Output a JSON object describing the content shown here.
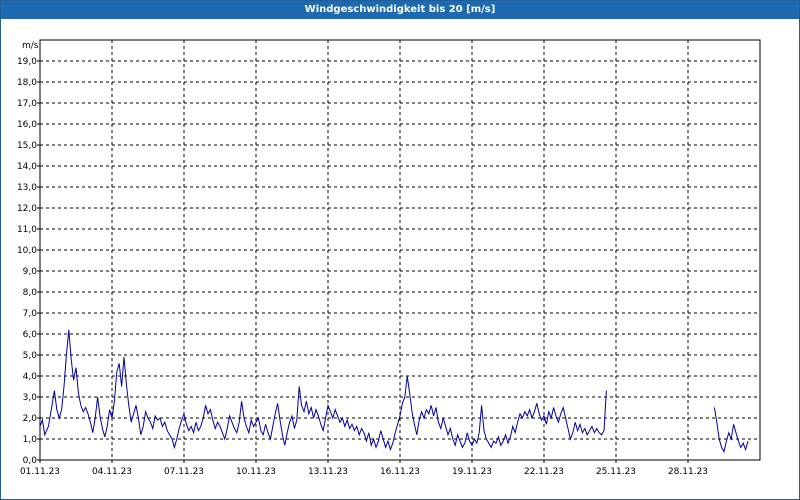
{
  "chart_data": {
    "type": "line",
    "title": "Windgeschwindigkeit bis 20 [m/s]",
    "ylabel": "m/s",
    "xlabel": "",
    "ylim": [
      0,
      20
    ],
    "xlim_days": [
      0,
      30
    ],
    "grid": true,
    "yticks": [
      "0,0",
      "1,0",
      "2,0",
      "3,0",
      "4,0",
      "5,0",
      "6,0",
      "7,0",
      "8,0",
      "9,0",
      "10,0",
      "11,0",
      "12,0",
      "13,0",
      "14,0",
      "15,0",
      "16,0",
      "17,0",
      "18,0",
      "19,0"
    ],
    "xticks": [
      "01.11.23",
      "04.11.23",
      "07.11.23",
      "10.11.23",
      "13.11.23",
      "16.11.23",
      "19.11.23",
      "22.11.23",
      "25.11.23",
      "28.11.23"
    ],
    "line_color": "#0000a0",
    "series": [
      {
        "segments": [
          [
            [
              0.0,
              1.6
            ],
            [
              0.1,
              1.9
            ],
            [
              0.2,
              1.2
            ],
            [
              0.35,
              1.6
            ],
            [
              0.5,
              2.6
            ],
            [
              0.6,
              3.3
            ],
            [
              0.7,
              2.4
            ],
            [
              0.8,
              2.0
            ],
            [
              0.9,
              2.4
            ],
            [
              1.0,
              3.5
            ],
            [
              1.1,
              5.0
            ],
            [
              1.2,
              6.2
            ],
            [
              1.3,
              4.8
            ],
            [
              1.4,
              3.8
            ],
            [
              1.5,
              4.4
            ],
            [
              1.6,
              3.2
            ],
            [
              1.7,
              2.6
            ],
            [
              1.8,
              2.3
            ],
            [
              1.9,
              2.5
            ],
            [
              2.0,
              2.2
            ],
            [
              2.1,
              1.8
            ],
            [
              2.2,
              1.3
            ],
            [
              2.3,
              2.0
            ],
            [
              2.4,
              3.0
            ],
            [
              2.5,
              2.1
            ],
            [
              2.6,
              1.5
            ],
            [
              2.7,
              1.1
            ],
            [
              2.8,
              1.6
            ],
            [
              2.9,
              2.4
            ],
            [
              3.0,
              2.0
            ],
            [
              3.1,
              2.8
            ],
            [
              3.2,
              4.2
            ],
            [
              3.3,
              4.6
            ],
            [
              3.4,
              3.5
            ],
            [
              3.5,
              4.9
            ],
            [
              3.6,
              3.6
            ],
            [
              3.7,
              2.6
            ],
            [
              3.8,
              1.8
            ],
            [
              3.9,
              2.2
            ],
            [
              4.0,
              2.6
            ],
            [
              4.1,
              2.0
            ],
            [
              4.2,
              1.2
            ],
            [
              4.3,
              1.6
            ],
            [
              4.4,
              2.3
            ],
            [
              4.5,
              2.0
            ],
            [
              4.6,
              1.8
            ],
            [
              4.7,
              1.5
            ],
            [
              4.8,
              2.1
            ],
            [
              4.9,
              1.9
            ],
            [
              5.0,
              2.0
            ],
            [
              5.1,
              1.6
            ],
            [
              5.2,
              1.8
            ],
            [
              5.3,
              1.4
            ],
            [
              5.4,
              1.2
            ],
            [
              5.5,
              1.0
            ],
            [
              5.6,
              0.6
            ],
            [
              5.7,
              1.0
            ],
            [
              5.8,
              1.5
            ],
            [
              5.9,
              1.9
            ],
            [
              6.0,
              2.2
            ],
            [
              6.1,
              1.7
            ],
            [
              6.2,
              1.4
            ],
            [
              6.3,
              1.6
            ],
            [
              6.4,
              1.3
            ],
            [
              6.5,
              1.8
            ],
            [
              6.6,
              1.4
            ],
            [
              6.7,
              1.6
            ],
            [
              6.8,
              2.0
            ],
            [
              6.9,
              2.6
            ],
            [
              7.0,
              2.2
            ],
            [
              7.1,
              2.4
            ],
            [
              7.2,
              1.9
            ],
            [
              7.3,
              1.5
            ],
            [
              7.4,
              1.8
            ],
            [
              7.5,
              1.6
            ],
            [
              7.6,
              1.3
            ],
            [
              7.7,
              1.0
            ],
            [
              7.8,
              1.5
            ],
            [
              7.9,
              2.1
            ],
            [
              8.0,
              1.8
            ],
            [
              8.1,
              1.5
            ],
            [
              8.2,
              1.3
            ],
            [
              8.3,
              1.8
            ],
            [
              8.4,
              2.8
            ],
            [
              8.5,
              2.0
            ],
            [
              8.6,
              1.6
            ],
            [
              8.7,
              1.3
            ],
            [
              8.8,
              1.9
            ],
            [
              8.9,
              1.6
            ],
            [
              9.0,
              1.8
            ],
            [
              9.1,
              2.0
            ],
            [
              9.2,
              1.4
            ],
            [
              9.3,
              1.2
            ],
            [
              9.4,
              1.7
            ],
            [
              9.5,
              1.3
            ],
            [
              9.6,
              1.0
            ],
            [
              9.7,
              1.6
            ],
            [
              9.8,
              2.2
            ],
            [
              9.9,
              2.7
            ],
            [
              10.0,
              1.9
            ],
            [
              10.1,
              1.2
            ],
            [
              10.2,
              0.7
            ],
            [
              10.3,
              1.3
            ],
            [
              10.4,
              1.8
            ],
            [
              10.5,
              2.1
            ],
            [
              10.6,
              1.5
            ],
            [
              10.7,
              1.9
            ],
            [
              10.8,
              3.5
            ],
            [
              10.9,
              2.6
            ],
            [
              11.0,
              2.3
            ],
            [
              11.1,
              2.8
            ],
            [
              11.2,
              2.2
            ],
            [
              11.3,
              2.5
            ],
            [
              11.4,
              2.0
            ],
            [
              11.5,
              2.4
            ],
            [
              11.6,
              2.1
            ],
            [
              11.7,
              1.7
            ],
            [
              11.8,
              1.4
            ],
            [
              11.9,
              2.0
            ],
            [
              12.0,
              2.6
            ],
            [
              12.1,
              2.3
            ],
            [
              12.2,
              2.0
            ],
            [
              12.3,
              2.4
            ],
            [
              12.4,
              2.1
            ],
            [
              12.5,
              1.8
            ],
            [
              12.6,
              2.0
            ],
            [
              12.7,
              1.6
            ],
            [
              12.8,
              1.9
            ],
            [
              12.9,
              1.5
            ],
            [
              13.0,
              1.7
            ],
            [
              13.1,
              1.4
            ],
            [
              13.2,
              1.6
            ],
            [
              13.3,
              1.2
            ],
            [
              13.4,
              1.5
            ],
            [
              13.5,
              1.3
            ],
            [
              13.6,
              0.9
            ],
            [
              13.7,
              1.3
            ],
            [
              13.8,
              0.7
            ],
            [
              13.9,
              1.0
            ],
            [
              14.0,
              0.6
            ],
            [
              14.1,
              0.9
            ],
            [
              14.2,
              1.4
            ],
            [
              14.3,
              1.0
            ],
            [
              14.4,
              0.6
            ],
            [
              14.5,
              0.9
            ],
            [
              14.6,
              0.5
            ],
            [
              14.7,
              0.8
            ],
            [
              14.8,
              1.3
            ],
            [
              14.9,
              1.7
            ],
            [
              15.0,
              2.1
            ],
            [
              15.1,
              2.7
            ],
            [
              15.2,
              3.0
            ],
            [
              15.3,
              4.0
            ],
            [
              15.4,
              3.2
            ],
            [
              15.5,
              2.3
            ],
            [
              15.6,
              1.7
            ],
            [
              15.7,
              1.2
            ],
            [
              15.8,
              1.9
            ],
            [
              15.9,
              2.3
            ],
            [
              16.0,
              2.0
            ],
            [
              16.1,
              2.4
            ],
            [
              16.2,
              2.2
            ],
            [
              16.3,
              2.6
            ],
            [
              16.4,
              2.1
            ],
            [
              16.5,
              2.5
            ],
            [
              16.6,
              1.8
            ],
            [
              16.7,
              1.5
            ],
            [
              16.8,
              2.0
            ],
            [
              16.9,
              1.6
            ],
            [
              17.0,
              1.2
            ],
            [
              17.1,
              1.5
            ],
            [
              17.2,
              1.0
            ],
            [
              17.3,
              0.7
            ],
            [
              17.4,
              1.2
            ],
            [
              17.5,
              0.9
            ],
            [
              17.6,
              0.6
            ],
            [
              17.7,
              0.8
            ],
            [
              17.8,
              1.3
            ],
            [
              17.9,
              0.9
            ],
            [
              18.0,
              0.7
            ],
            [
              18.1,
              1.0
            ],
            [
              18.2,
              0.8
            ],
            [
              18.3,
              1.3
            ],
            [
              18.4,
              2.6
            ],
            [
              18.5,
              1.4
            ],
            [
              18.6,
              1.0
            ],
            [
              18.7,
              0.8
            ],
            [
              18.8,
              0.6
            ],
            [
              18.9,
              0.9
            ],
            [
              19.0,
              0.8
            ],
            [
              19.1,
              1.1
            ],
            [
              19.2,
              0.7
            ],
            [
              19.3,
              0.9
            ],
            [
              19.4,
              1.2
            ],
            [
              19.5,
              0.8
            ],
            [
              19.6,
              1.1
            ],
            [
              19.7,
              1.6
            ],
            [
              19.8,
              1.3
            ],
            [
              19.9,
              1.8
            ],
            [
              20.0,
              2.2
            ],
            [
              20.1,
              2.0
            ],
            [
              20.2,
              2.3
            ],
            [
              20.3,
              2.1
            ],
            [
              20.4,
              2.4
            ],
            [
              20.5,
              2.0
            ],
            [
              20.6,
              2.3
            ],
            [
              20.7,
              2.7
            ],
            [
              20.8,
              2.2
            ],
            [
              20.9,
              1.9
            ],
            [
              21.0,
              2.1
            ],
            [
              21.1,
              1.7
            ],
            [
              21.2,
              2.3
            ],
            [
              21.3,
              2.0
            ],
            [
              21.4,
              2.5
            ],
            [
              21.5,
              2.1
            ],
            [
              21.6,
              1.8
            ],
            [
              21.7,
              2.2
            ],
            [
              21.8,
              2.5
            ],
            [
              21.9,
              2.0
            ],
            [
              22.0,
              1.5
            ],
            [
              22.1,
              1.0
            ],
            [
              22.2,
              1.3
            ],
            [
              22.3,
              1.8
            ],
            [
              22.4,
              1.4
            ],
            [
              22.5,
              1.7
            ],
            [
              22.6,
              1.3
            ],
            [
              22.7,
              1.5
            ],
            [
              22.8,
              1.2
            ],
            [
              22.9,
              1.4
            ],
            [
              23.0,
              1.6
            ],
            [
              23.1,
              1.3
            ],
            [
              23.2,
              1.5
            ],
            [
              23.3,
              1.3
            ],
            [
              23.4,
              1.2
            ],
            [
              23.5,
              1.4
            ],
            [
              23.6,
              3.3
            ]
          ],
          [
            [
              28.1,
              2.5
            ],
            [
              28.2,
              1.8
            ],
            [
              28.3,
              1.0
            ],
            [
              28.4,
              0.6
            ],
            [
              28.5,
              0.4
            ],
            [
              28.6,
              0.9
            ],
            [
              28.7,
              1.3
            ],
            [
              28.8,
              1.0
            ],
            [
              28.9,
              1.7
            ],
            [
              29.0,
              1.3
            ],
            [
              29.1,
              0.9
            ],
            [
              29.2,
              0.6
            ],
            [
              29.3,
              0.8
            ],
            [
              29.4,
              0.5
            ],
            [
              29.5,
              0.9
            ]
          ]
        ]
      }
    ]
  }
}
